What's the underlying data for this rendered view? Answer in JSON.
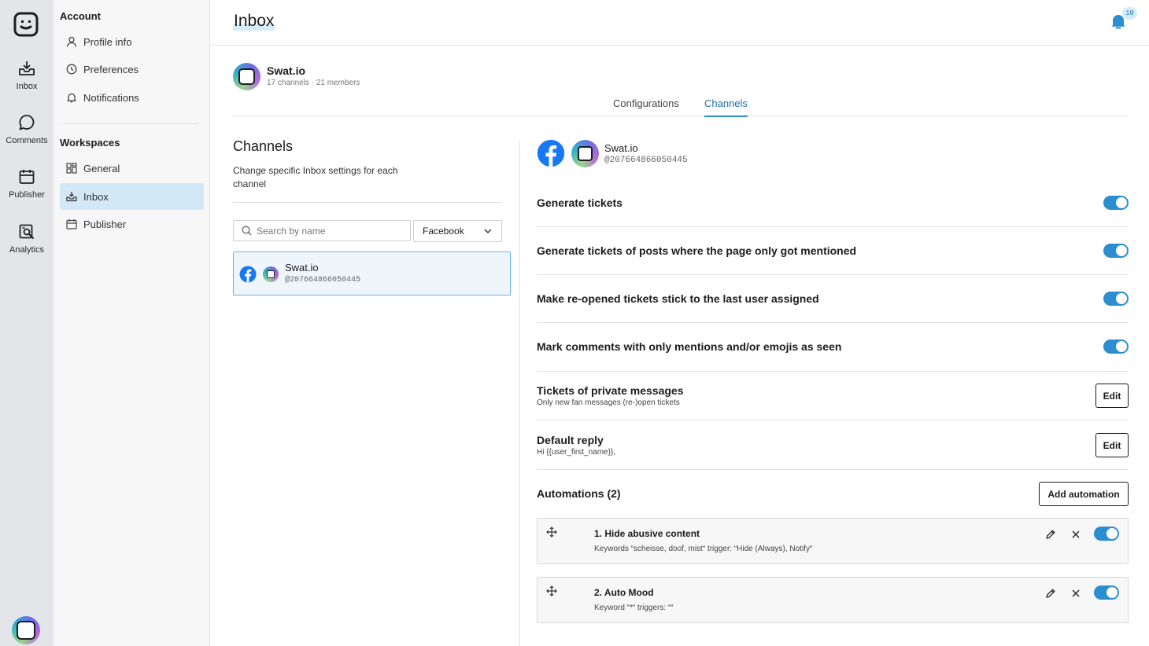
{
  "rail": {
    "items": [
      {
        "label": "Inbox",
        "icon": "inbox-icon"
      },
      {
        "label": "Comments",
        "icon": "comment-icon"
      },
      {
        "label": "Publisher",
        "icon": "calendar-icon"
      },
      {
        "label": "Analytics",
        "icon": "analytics-icon"
      }
    ]
  },
  "sidebar": {
    "account_heading": "Account",
    "account_items": [
      {
        "label": "Profile info",
        "icon": "user-icon"
      },
      {
        "label": "Preferences",
        "icon": "clock-icon"
      },
      {
        "label": "Notifications",
        "icon": "bell-icon"
      }
    ],
    "workspaces_heading": "Workspaces",
    "workspace_items": [
      {
        "label": "General",
        "icon": "grid-icon"
      },
      {
        "label": "Inbox",
        "icon": "inbox-icon",
        "active": true
      },
      {
        "label": "Publisher",
        "icon": "calendar-icon"
      }
    ]
  },
  "header": {
    "title": "Inbox",
    "notification_count": "10"
  },
  "workspace": {
    "name": "Swat.io",
    "meta": "17 channels · 21 members"
  },
  "tabs": [
    {
      "label": "Configurations",
      "active": false
    },
    {
      "label": "Channels",
      "active": true
    }
  ],
  "channels": {
    "title": "Channels",
    "description": "Change specific Inbox settings for each channel",
    "search_placeholder": "Search by name",
    "network_filter": "Facebook",
    "list": [
      {
        "name": "Swat.io",
        "handle": "@207664866050445",
        "selected": true
      }
    ]
  },
  "detail": {
    "name": "Swat.io",
    "handle": "@207664866050445",
    "toggles": [
      {
        "label": "Generate tickets",
        "on": true
      },
      {
        "label": "Generate tickets of posts where the page only got mentioned",
        "on": true
      },
      {
        "label": "Make re-opened tickets stick to the last user assigned",
        "on": true
      },
      {
        "label": "Mark comments with only mentions and/or emojis as seen",
        "on": true
      }
    ],
    "private_messages": {
      "label": "Tickets of private messages",
      "sub": "Only new fan messages (re-)open tickets",
      "button": "Edit"
    },
    "default_reply": {
      "label": "Default reply",
      "sub": "Hi {{user_first_name}},",
      "button": "Edit"
    },
    "automations": {
      "title": "Automations (2)",
      "add_button": "Add automation",
      "items": [
        {
          "title": "1. Hide abusive content",
          "desc": "Keywords “scheisse, doof, mist“ trigger: “Hide (Always), Notify“",
          "on": true
        },
        {
          "title": "2. Auto Mood",
          "desc": "Keyword “*“ triggers: ““",
          "on": true
        }
      ]
    }
  },
  "colors": {
    "accent": "#2a8ecf",
    "rail_bg": "#e3e5e8",
    "active_item_bg": "#d2e8f7",
    "facebook": "#1877f2"
  }
}
